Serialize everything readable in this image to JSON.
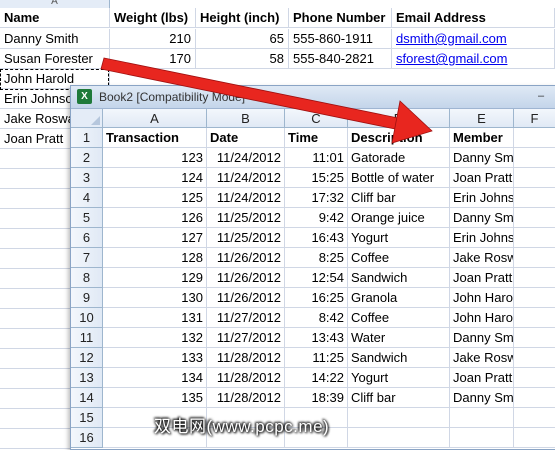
{
  "back_sheet": {
    "col_header_letter": "A",
    "header": [
      "Name",
      "Weight (lbs)",
      "Height (inch)",
      "Phone Number",
      "Email Address"
    ],
    "rows": [
      [
        "Danny Smith",
        "210",
        "65",
        "555-860-1911",
        "dsmith@gmail.com"
      ],
      [
        "Susan Forester",
        "170",
        "58",
        "555-840-2821",
        "sforest@gmail.com"
      ],
      [
        "John Harold",
        "",
        "",
        "",
        ""
      ],
      [
        "Erin Johnson",
        "",
        "",
        "",
        ""
      ],
      [
        "Jake Roswald",
        "",
        "",
        "",
        ""
      ],
      [
        "Joan Pratt",
        "",
        "",
        "",
        ""
      ]
    ]
  },
  "window": {
    "icon_label": "X",
    "title": "Book2  [Compatibility Mode]",
    "minimize": "–",
    "columns": [
      "A",
      "B",
      "C",
      "D",
      "E",
      "F"
    ],
    "row_numbers": [
      "1",
      "2",
      "3",
      "4",
      "5",
      "6",
      "7",
      "8",
      "9",
      "10",
      "11",
      "12",
      "13",
      "14",
      "15",
      "16"
    ],
    "header": [
      "Transaction",
      "Date",
      "Time",
      "Description",
      "Member"
    ],
    "rows": [
      [
        "123",
        "11/24/2012",
        "11:01",
        "Gatorade",
        "Danny Smith"
      ],
      [
        "124",
        "11/24/2012",
        "15:25",
        "Bottle of water",
        "Joan Pratt"
      ],
      [
        "125",
        "11/24/2012",
        "17:32",
        "Cliff bar",
        "Erin Johnson"
      ],
      [
        "126",
        "11/25/2012",
        "9:42",
        "Orange juice",
        "Danny Smith"
      ],
      [
        "127",
        "11/25/2012",
        "16:43",
        "Yogurt",
        "Erin Johnson"
      ],
      [
        "128",
        "11/26/2012",
        "8:25",
        "Coffee",
        "Jake Roswald"
      ],
      [
        "129",
        "11/26/2012",
        "12:54",
        "Sandwich",
        "Joan Pratt"
      ],
      [
        "130",
        "11/26/2012",
        "16:25",
        "Granola",
        "John Harold"
      ],
      [
        "131",
        "11/27/2012",
        "8:42",
        "Coffee",
        "John Harold"
      ],
      [
        "132",
        "11/27/2012",
        "13:43",
        "Water",
        "Danny Smith"
      ],
      [
        "133",
        "11/28/2012",
        "11:25",
        "Sandwich",
        "Jake Roswald"
      ],
      [
        "134",
        "11/28/2012",
        "14:22",
        "Yogurt",
        "Joan Pratt"
      ],
      [
        "135",
        "11/28/2012",
        "18:39",
        "Cliff bar",
        "Danny Smith"
      ]
    ]
  },
  "watermark": "双电网(www.pcpc.me)",
  "colors": {
    "arrow": "#e8261f",
    "header_fill": "#e4ecf7",
    "link": "#0000ee"
  }
}
